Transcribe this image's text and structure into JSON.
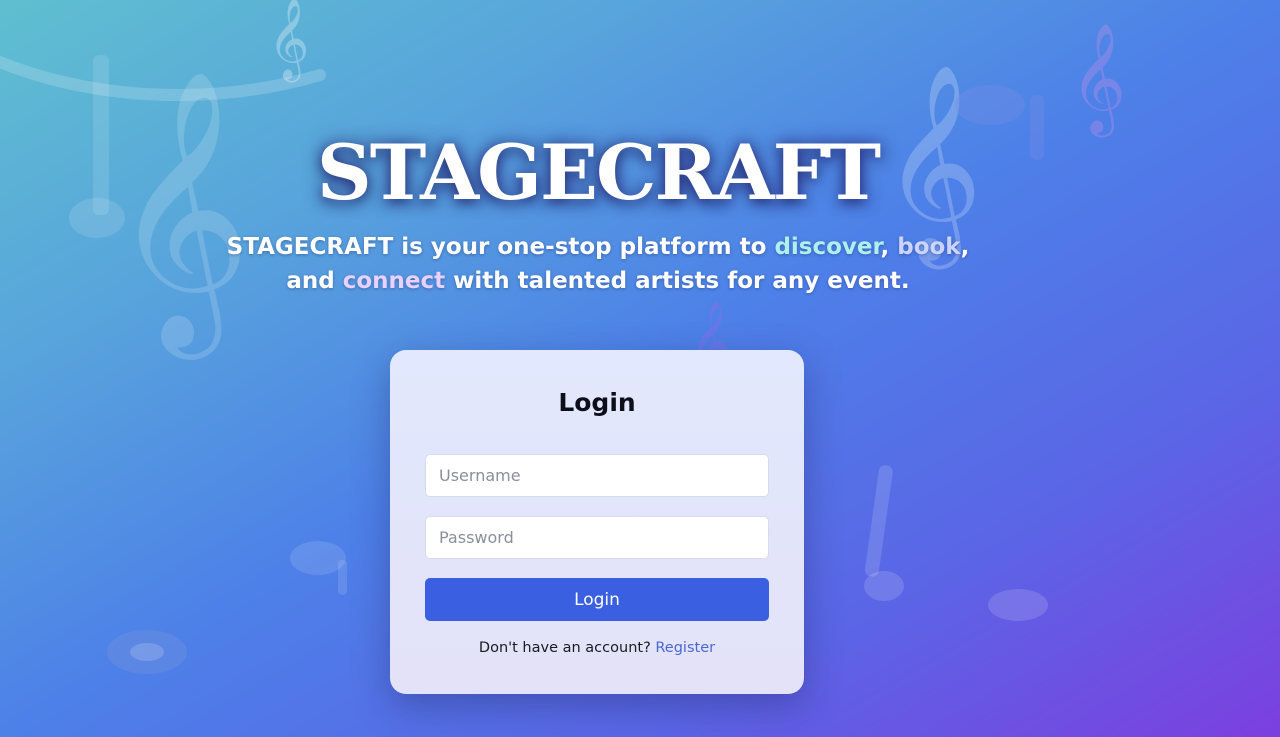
{
  "hero": {
    "title": "STAGECRAFT",
    "tagline": {
      "part1": "STAGECRAFT is your one-stop platform to ",
      "discover": "discover",
      "comma": ", ",
      "book": "book",
      "part2": ",",
      "part3": "and ",
      "connect": "connect",
      "part4": " with talented artists for any event."
    }
  },
  "login": {
    "title": "Login",
    "username_placeholder": "Username",
    "password_placeholder": "Password",
    "button_label": "Login",
    "register_prompt": "Don't have an account?",
    "register_link": "Register"
  },
  "colors": {
    "button": "#3a5fe0",
    "link": "#4a68d0",
    "highlight_discover": "#aef0ec",
    "highlight_book": "#c9d4ff",
    "highlight_connect": "#e8d0ff"
  },
  "decor_icons": [
    "treble-clef-icon",
    "music-note-icon",
    "staff-line-icon"
  ]
}
